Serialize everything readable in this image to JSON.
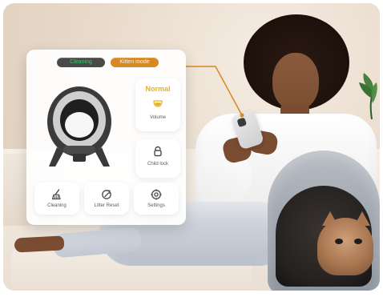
{
  "colors": {
    "accent_orange": "#D7881E",
    "normal_yellow": "#E4B12A",
    "cleaning_green": "#38C76D"
  },
  "card": {
    "pills": {
      "cleaning": "Cleaning",
      "kitten_mode": "Kitten mode"
    },
    "status": {
      "mode": "Normal",
      "label": "Volume"
    },
    "tiles": {
      "child_lock": "Child lock",
      "cleaning": "Cleaning",
      "litter_reset": "Litter Reset",
      "settings": "Settings"
    }
  }
}
